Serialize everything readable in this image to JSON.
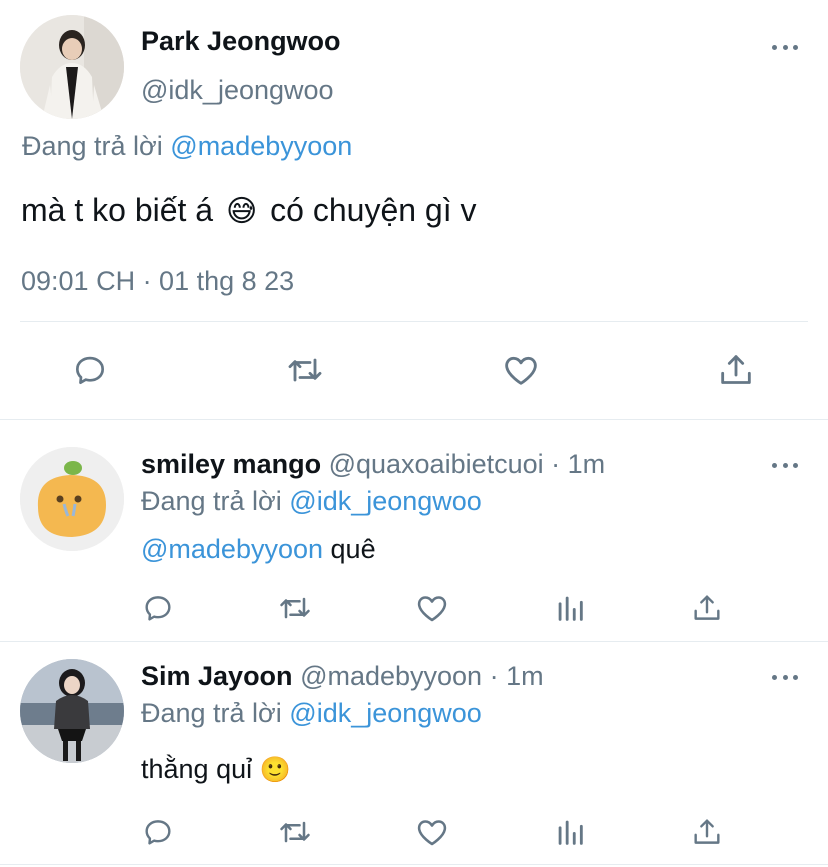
{
  "main_tweet": {
    "name": "Park Jeongwoo",
    "handle": "@idk_jeongwoo",
    "reply_prefix": "Đang trả lời",
    "reply_to": "@madebyyoon",
    "text_before": "mà t ko biết á",
    "emoji": "😅",
    "text_after": "có chuyện gì v",
    "timestamp": "09:01 CH · 01 thg 8 23"
  },
  "replies": [
    {
      "name": "smiley mango",
      "handle": "@quaxoaibietcuoi",
      "time": "· 1m",
      "reply_prefix": "Đang trả lời",
      "reply_to": "@idk_jeongwoo",
      "mention": "@madebyyoon",
      "text": "quê"
    },
    {
      "name": "Sim Jayoon",
      "handle": "@madebyyoon",
      "time": "· 1m",
      "reply_prefix": "Đang trả lời",
      "reply_to": "@idk_jeongwoo",
      "text": "thằng quỉ",
      "emoji": "🙂"
    }
  ],
  "icons": {
    "reply": "reply-icon",
    "retweet": "retweet-icon",
    "like": "like-icon",
    "share": "share-icon",
    "analytics": "analytics-icon",
    "more": "more-icon"
  },
  "colors": {
    "text": "#0f1419",
    "secondary": "#657786",
    "link": "#3b94d9",
    "divider": "#e6ecf0"
  }
}
